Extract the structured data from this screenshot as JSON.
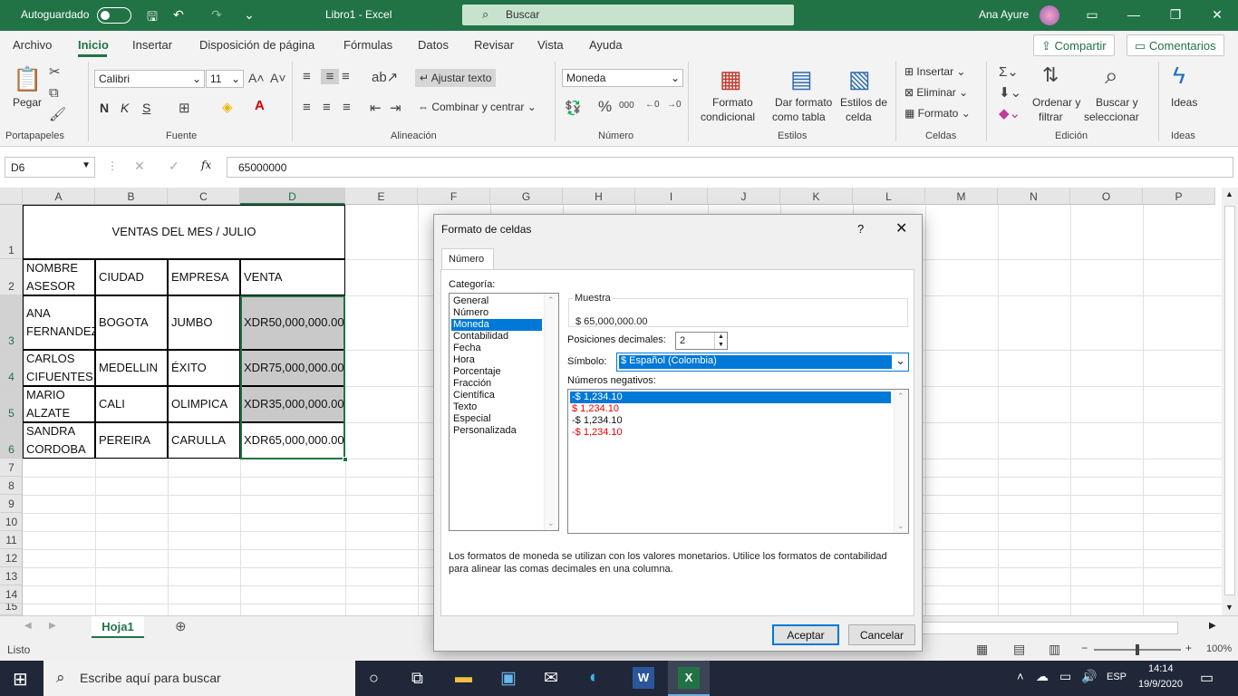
{
  "titlebar": {
    "autosave": "Autoguardado",
    "title": "Libro1  -  Excel",
    "search": "Buscar",
    "user": "Ana Ayure"
  },
  "menu": {
    "items": [
      "Archivo",
      "Inicio",
      "Insertar",
      "Disposición de página",
      "Fórmulas",
      "Datos",
      "Revisar",
      "Vista",
      "Ayuda"
    ],
    "active": "Inicio",
    "share": "Compartir",
    "comments": "Comentarios"
  },
  "ribbon": {
    "paste": "Pegar",
    "font_name": "Calibri",
    "font_size": "11",
    "bold": "N",
    "italic": "K",
    "underline": "S",
    "wrap_text": "Ajustar texto",
    "merge_center": "Combinar y centrar",
    "number_format": "Moneda",
    "cond_format_1": "Formato",
    "cond_format_2": "condicional",
    "table_format_1": "Dar formato",
    "table_format_2": "como tabla",
    "cell_styles_1": "Estilos de",
    "cell_styles_2": "celda",
    "insert": "Insertar",
    "delete": "Eliminar",
    "format": "Formato",
    "sort_1": "Ordenar y",
    "sort_2": "filtrar",
    "find_1": "Buscar y",
    "find_2": "seleccionar",
    "ideas": "Ideas",
    "groups": [
      "Portapapeles",
      "Fuente",
      "Alineación",
      "Número",
      "Estilos",
      "Celdas",
      "Edición",
      "Ideas"
    ]
  },
  "formula_bar": {
    "name_box": "D6",
    "fx": "fx",
    "value": "65000000"
  },
  "sheet": {
    "columns": [
      "A",
      "B",
      "C",
      "D",
      "E",
      "F",
      "G",
      "H",
      "I",
      "J",
      "K",
      "L",
      "M",
      "N",
      "O",
      "P"
    ],
    "rows": [
      "1",
      "2",
      "3",
      "4",
      "5",
      "6",
      "7",
      "8",
      "9",
      "10",
      "11",
      "12",
      "13",
      "14",
      "15"
    ],
    "title": "VENTAS DEL MES / JULIO",
    "headers": {
      "a": "NOMBRE ASESOR",
      "b": "CIUDAD",
      "c": "EMPRESA",
      "d": "VENTA"
    },
    "data": [
      {
        "a": "ANA FERNANDEZ",
        "b": "BOGOTA",
        "c": "JUMBO",
        "d": "XDR50,000,000.00"
      },
      {
        "a": "CARLOS CIFUENTES",
        "b": "MEDELLIN",
        "c": "ÉXITO",
        "d": "XDR75,000,000.00"
      },
      {
        "a": "MARIO ALZATE",
        "b": "CALI",
        "c": "OLIMPICA",
        "d": "XDR35,000,000.00"
      },
      {
        "a": "SANDRA CORDOBA",
        "b": "PEREIRA",
        "c": "CARULLA",
        "d": "XDR65,000,000.00"
      }
    ]
  },
  "sheet_tabs": {
    "active": "Hoja1"
  },
  "status": {
    "ready": "Listo",
    "zoom": "100%"
  },
  "dialog": {
    "title": "Formato de celdas",
    "help": "?",
    "tab": "Número",
    "category_label": "Categoría:",
    "categories": [
      "General",
      "Número",
      "Moneda",
      "Contabilidad",
      "Fecha",
      "Hora",
      "Porcentaje",
      "Fracción",
      "Científica",
      "Texto",
      "Especial",
      "Personalizada"
    ],
    "selected_category": "Moneda",
    "sample_label": "Muestra",
    "sample_value": "$ 65,000,000.00",
    "decimals_label": "Posiciones decimales:",
    "decimals_value": "2",
    "symbol_label": "Símbolo:",
    "symbol_value": "$ Español (Colombia)",
    "negatives_label": "Números negativos:",
    "negatives": [
      "-$ 1,234.10",
      "$ 1,234.10",
      "-$ 1,234.10",
      "-$ 1,234.10"
    ],
    "description": "Los formatos de moneda se utilizan con los valores monetarios. Utilice los formatos de contabilidad para alinear las comas decimales en una columna.",
    "ok": "Aceptar",
    "cancel": "Cancelar"
  },
  "taskbar": {
    "search": "Escribe aquí para buscar",
    "lang": "ESP",
    "time": "14:14",
    "date": "19/9/2020"
  }
}
